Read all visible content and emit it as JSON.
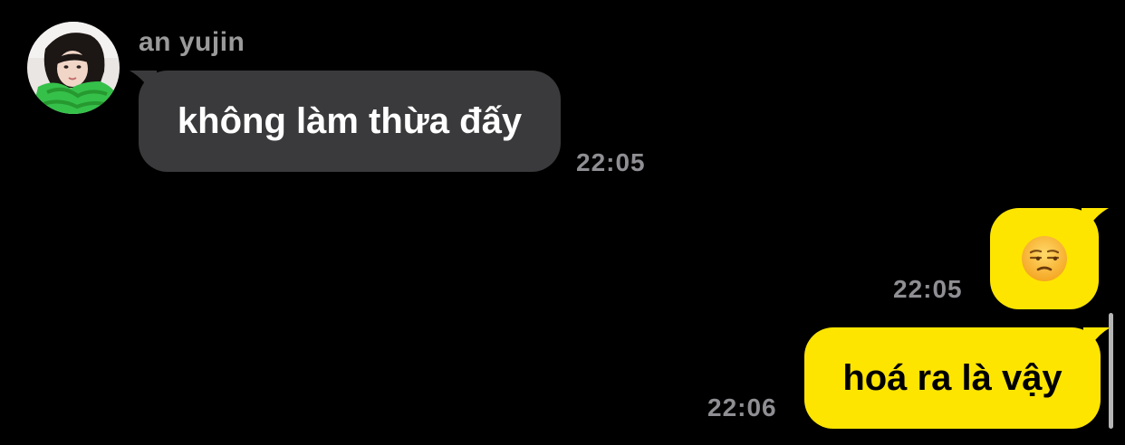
{
  "chat": {
    "contact": {
      "name": "an yujin",
      "avatar_icon": "profile-photo"
    },
    "messages": [
      {
        "direction": "incoming",
        "text": "không làm thừa đấy",
        "time": "22:05"
      },
      {
        "direction": "outgoing",
        "emoji": "unamused-face",
        "time": "22:05"
      },
      {
        "direction": "outgoing",
        "text": "hoá ra là vậy",
        "time": "22:06"
      }
    ]
  },
  "colors": {
    "background": "#000000",
    "incoming_bubble": "#3a3a3c",
    "outgoing_bubble": "#fee500",
    "timestamp": "#8e8e93",
    "sender_name": "#9a9a9a"
  }
}
